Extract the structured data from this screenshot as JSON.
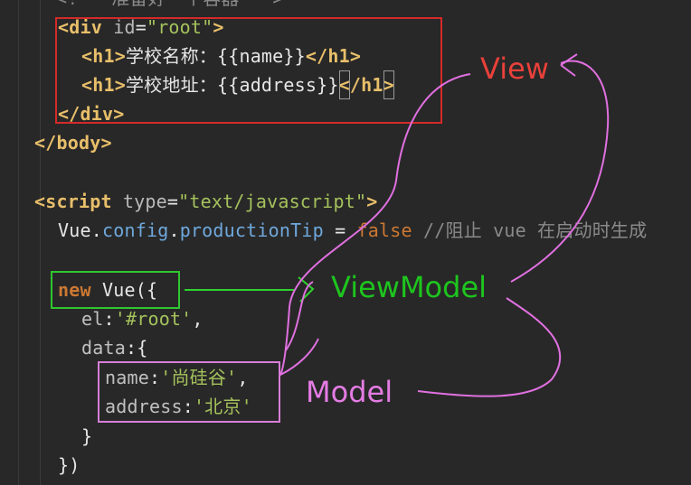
{
  "editor": {
    "lines": {
      "l0": {
        "head": "<!-- ",
        "text": "准备好一个容器",
        "tail": " -->"
      },
      "l1": {
        "open": "<div ",
        "attr": "id",
        "eq": "=",
        "val": "\"root\"",
        "close": ">"
      },
      "l2": {
        "open": "<h1>",
        "text": "学校名称：{{name}}",
        "close": "</h1>"
      },
      "l3": {
        "open": "<h1>",
        "text": "学校地址：{{address}}",
        "close_lt": "<",
        "close_rest": "/h1",
        "close_gt": ">"
      },
      "l4": {
        "tag": "</div>"
      },
      "l5": {
        "tag": "</body>"
      },
      "l7": {
        "open": "<script ",
        "attr": "type",
        "eq": "=",
        "val": "\"text/javascript\"",
        "close": ">"
      },
      "l8": {
        "obj": "Vue",
        "dot1": ".",
        "p1": "config",
        "dot2": ".",
        "p2": "productionTip",
        "op": " = ",
        "bool": "false",
        "comment": " //阻止 vue 在启动时生成"
      },
      "l9": {
        "kw": "new ",
        "cls": "Vue",
        "punct": "({"
      },
      "l10": {
        "key": "el",
        "colon": ":",
        "val": "'#root'",
        "comma": ","
      },
      "l11": {
        "key": "data",
        "colon": ":",
        "brace": "{"
      },
      "l12": {
        "key": "name",
        "colon": ":",
        "val": "'尚硅谷'",
        "comma": ","
      },
      "l13": {
        "key": "address",
        "colon": ":",
        "val": "'北京'"
      },
      "l14": {
        "brace": "}"
      },
      "l15": {
        "brace": "})"
      }
    }
  },
  "annotations": {
    "view": {
      "text": "View",
      "color": "#e8413a"
    },
    "viewmodel": {
      "text": "ViewModel",
      "color": "#1ec51e"
    },
    "model": {
      "text": "Model",
      "color": "#e47ce4"
    },
    "box_colors": {
      "view": "#d42a2a",
      "viewmodel": "#2fc72f",
      "model": "#d77fd7"
    },
    "stroke_color_magenta": "#e070e0",
    "stroke_color_green": "#2fd22f"
  }
}
